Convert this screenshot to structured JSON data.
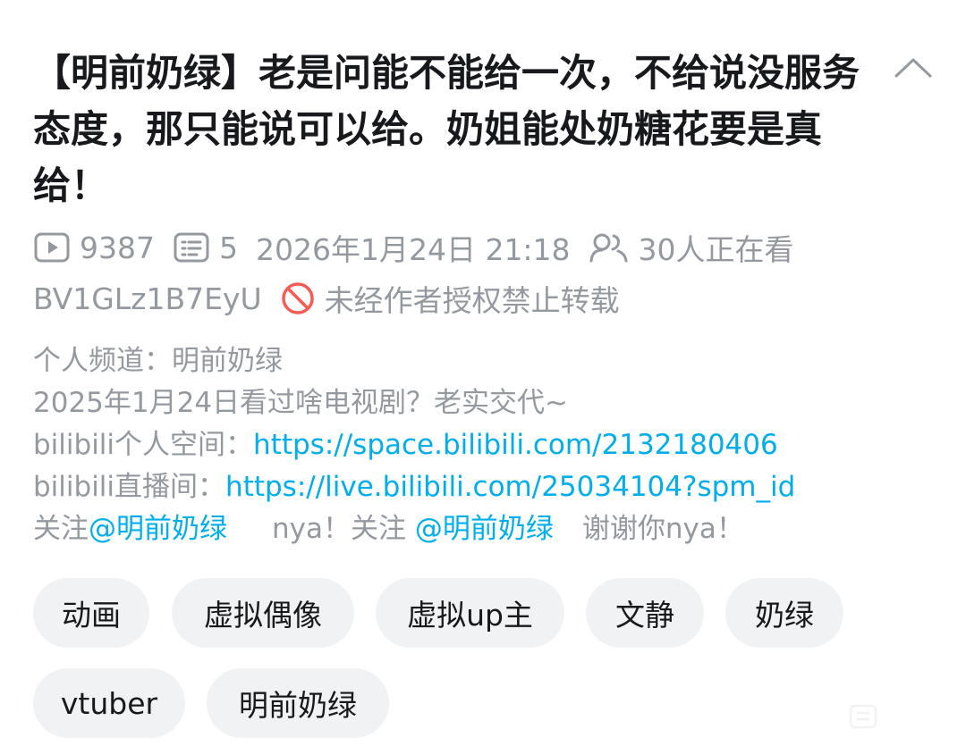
{
  "video": {
    "title": "【明前奶绿】老是问能不能给一次，不给说没服务态度，那只能说可以给。奶姐能处奶糖花要是真给！",
    "plays": "9387",
    "comments": "5",
    "datetime": "2026年1月24日 21:18",
    "watching": "30人正在看",
    "bvid": "BV1GLz1B7EyU",
    "no_repost": "未经作者授权禁止转载"
  },
  "description": {
    "line1": "个人频道：明前奶绿",
    "line2": "2025年1月24日看过啥电视剧？老实交代~",
    "space_label": "bilibili个人空间：",
    "space_link": "https://space.bilibili.com/2132180406",
    "live_label": "bilibili直播间：",
    "live_link": "https://live.bilibili.com/25034104?spm_id",
    "follow_prefix": "关注",
    "mention1": "@明前奶绿",
    "follow_mid": "nya！关注 ",
    "mention2": "@明前奶绿",
    "follow_suffix": "谢谢你nya！"
  },
  "tags": [
    "动画",
    "虚拟偶像",
    "虚拟up主",
    "文静",
    "奶绿",
    "vtuber",
    "明前奶绿"
  ],
  "icons": {
    "collapse": "chevron-up-icon",
    "plays": "play-count-icon",
    "comments": "danmaku-icon",
    "watching": "viewers-icon",
    "no_repost": "forbidden-icon"
  },
  "colors": {
    "link": "#00aeec",
    "forbidden": "#f85a54",
    "muted": "#9499a0",
    "tag_bg": "#f1f2f3"
  }
}
